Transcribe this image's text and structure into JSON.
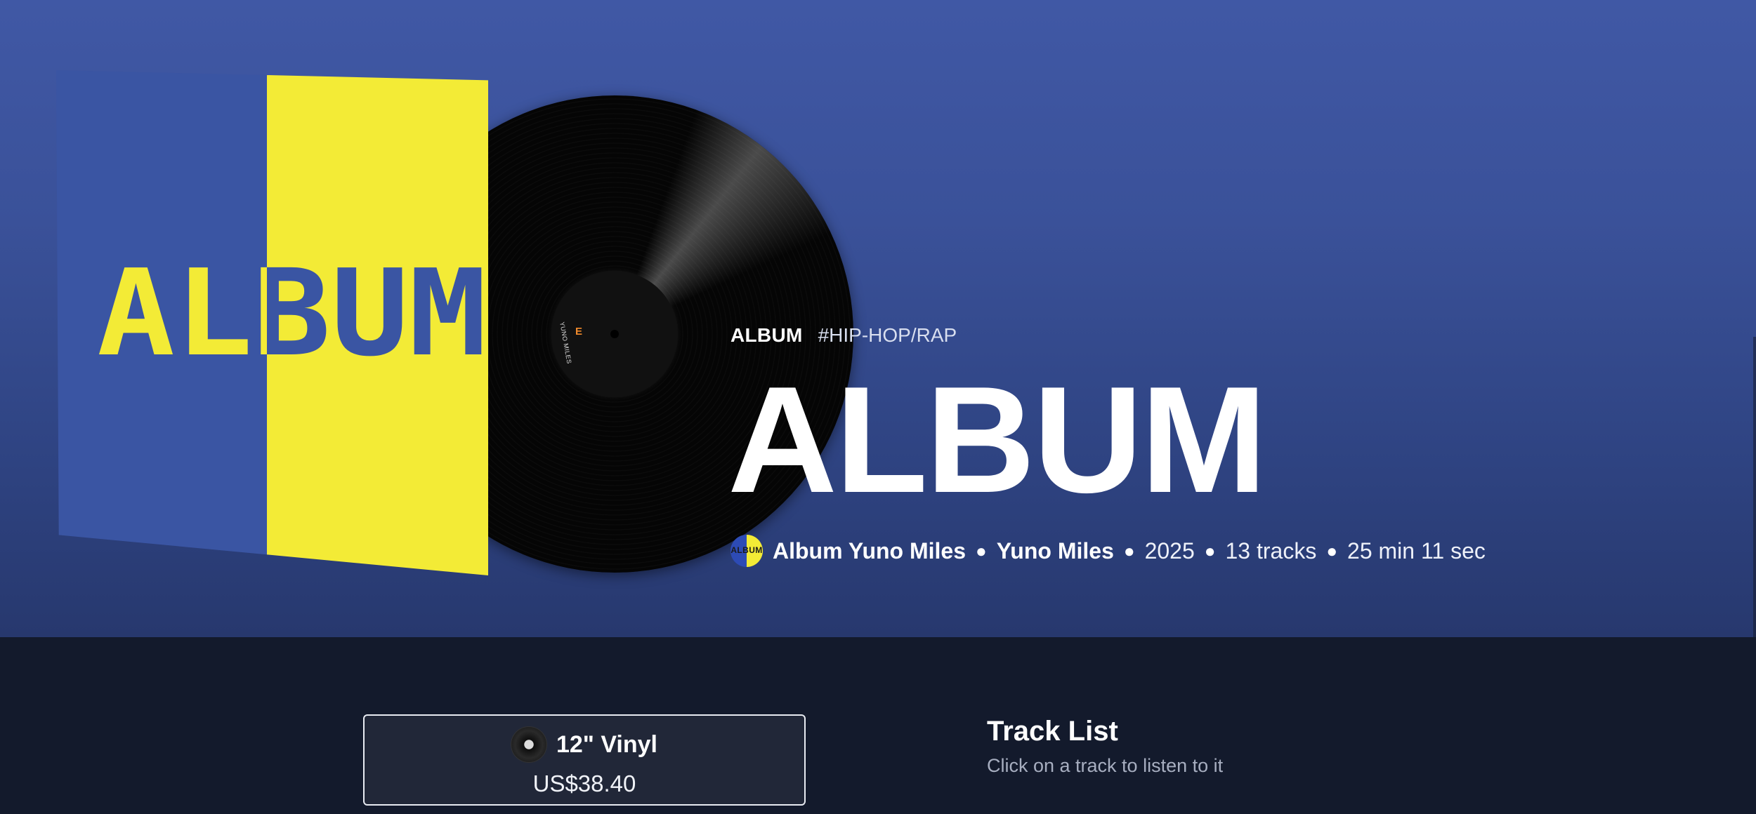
{
  "hero": {
    "type_label": "ALBUM",
    "genre_tag": "#HIP-HOP/RAP",
    "title": "ALBUM",
    "cover_word": "ALBUM",
    "vinyl_label_text": "YUNO MILES",
    "vinyl_label_mark": "E",
    "avatar_text": "ALBUM",
    "album_artist": "Album Yuno Miles",
    "artist": "Yuno Miles",
    "year": "2025",
    "tracks": "13 tracks",
    "duration": "25 min 11 sec",
    "separator": "●",
    "colors": {
      "gradient_top": "#4058a5",
      "gradient_bottom": "#27386e",
      "cover_blue": "#3a55a3",
      "cover_yellow": "#f3eb36"
    }
  },
  "format": {
    "name": "12\" Vinyl",
    "price": "US$38.40",
    "icon": "vinyl-record-icon"
  },
  "tracklist": {
    "title": "Track List",
    "subtitle": "Click on a track to listen to it"
  }
}
